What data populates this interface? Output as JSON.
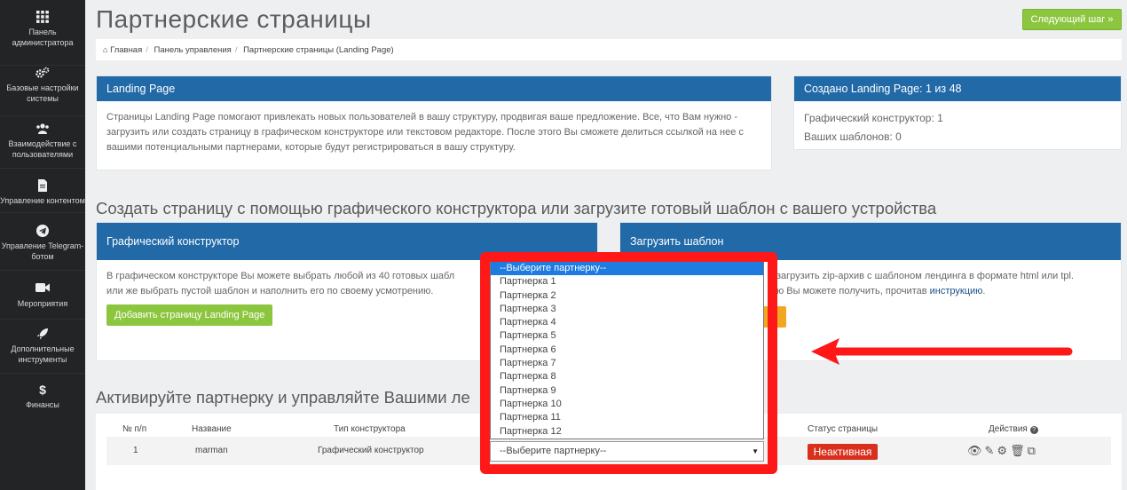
{
  "sidebar": {
    "items": [
      {
        "label": "Панель администратора",
        "icon": "grid-icon"
      },
      {
        "label": "Базовые настройки системы",
        "icon": "gears-icon"
      },
      {
        "label": "Взаимодействие с пользователями",
        "icon": "users-icon"
      },
      {
        "label": "Управление контентом",
        "icon": "file-icon"
      },
      {
        "label": "Управление Telegram-ботом",
        "icon": "telegram-icon"
      },
      {
        "label": "Мероприятия",
        "icon": "video-icon"
      },
      {
        "label": "Дополнительные инструменты",
        "icon": "rocket-icon"
      },
      {
        "label": "Финансы",
        "icon": "dollar-icon"
      }
    ]
  },
  "header": {
    "title": "Партнерские страницы",
    "next_button": "Следующий шаг »"
  },
  "breadcrumb": {
    "items": [
      "Главная",
      "Панель управления",
      "Партнерские страницы (Landing Page)"
    ]
  },
  "landing_panel": {
    "title": "Landing Page",
    "text": "Страницы Landing Page помогают привлекать новых пользователей в вашу структуру, продвигая ваше предложение. Все, что Вам нужно - загрузить или создать страницу в графическом конструкторе или текстовом редакторе. После этого Вы сможете делиться ссылкой на нее с вашими потенциальными партнерами, которые будут регистрироваться в вашу структуру."
  },
  "created_panel": {
    "title": "Создано Landing Page: 1 из 48",
    "graphic_label": "Графический конструктор:",
    "graphic_value": "1",
    "templates_label": "Ваших шаблонов:",
    "templates_value": "0"
  },
  "create_section": {
    "title": "Создать страницу с помощью графического конструктора или загрузите готовый шаблон с вашего устройства"
  },
  "graphic_panel": {
    "title": "Графический конструктор",
    "text": "В графическом конструкторе Вы можете выбрать любой из 40 готовых шабл",
    "text2": "или же выбрать пустой шаблон и наполнить его по своему усмотрению.",
    "button": "Добавить страницу Landing Page"
  },
  "upload_panel": {
    "title": "Загрузить шаблон",
    "text": "загрузить zip-архив с шаблоном лендинга в формате html или tpl.",
    "text2": "ю Вы можете получить, прочитав",
    "link": "инструкцию",
    "text3": "."
  },
  "activate_section": {
    "title": "Активируйте партнерку и управляйте Вашими ле"
  },
  "table": {
    "headers": [
      "№ п/п",
      "Название",
      "Тип конструктора",
      "Статус страницы",
      "Действия"
    ],
    "rows": [
      {
        "num": "1",
        "name": "marman",
        "type": "Графический конструктор",
        "status": "Неактивная"
      }
    ]
  },
  "partner_select": {
    "value": "--Выберите партнерку--",
    "options": [
      "--Выберите партнерку--",
      "Партнерка 1",
      "Партнерка 2",
      "Партнерка 3",
      "Партнерка 4",
      "Партнерка 5",
      "Партнерка 6",
      "Партнерка 7",
      "Партнерка 8",
      "Партнерка 9",
      "Партнерка 10",
      "Партнерка 11",
      "Партнерка 12"
    ]
  },
  "colors": {
    "accent_blue": "#2169a7",
    "green": "#8cc63f",
    "red_highlight": "#ff1818",
    "status_red": "#d9301e"
  }
}
